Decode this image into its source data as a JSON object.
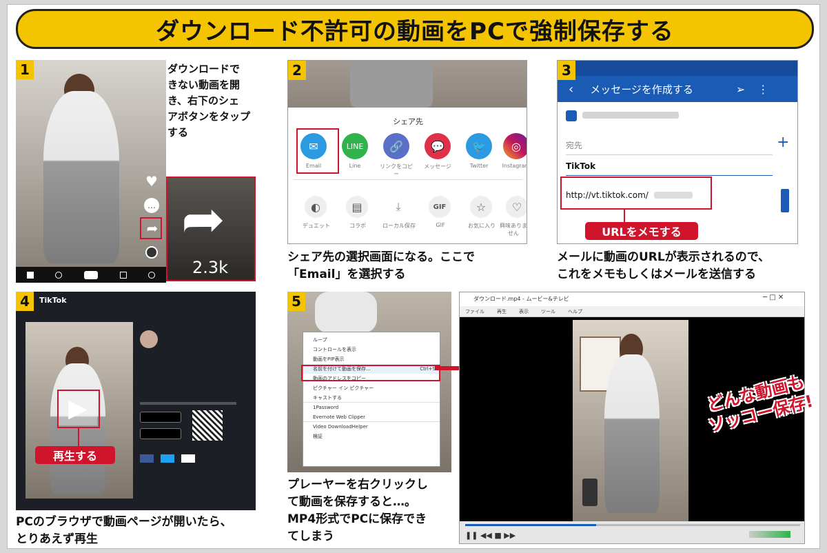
{
  "title": "ダウンロード不許可の動画をPCで強制保存する",
  "steps": [
    {
      "num": "1",
      "caption": [
        "ダウンロードで",
        "きない動画を開",
        "き、右下のシェ",
        "アボタンをタップ",
        "する"
      ]
    },
    {
      "num": "2",
      "caption": [
        "シェア先の選択画面になる。ここで",
        "「Email」を選択する"
      ]
    },
    {
      "num": "3",
      "caption": [
        "メールに動画のURLが表示されるので、",
        "これをメモもしくはメールを送信する"
      ]
    },
    {
      "num": "4",
      "caption": [
        "PCのブラウザで動画ページが開いたら、",
        "とりあえず再生"
      ]
    },
    {
      "num": "5",
      "caption": [
        "プレーヤーを右クリックし",
        "て動画を保存すると…。",
        "MP4形式でPCに保存でき",
        "てしまう"
      ]
    }
  ],
  "step1": {
    "share_count": "2.3k"
  },
  "step2": {
    "sheet_title": "シェア先",
    "share_targets": [
      "Email",
      "Line",
      "リンクをコピー",
      "メッセージ",
      "Twitter",
      "Instagram"
    ],
    "actions": [
      "デュエット",
      "コラボ",
      "ローカル保存",
      "GIF",
      "お気に入り",
      "興味ありません"
    ],
    "gif_label": "GIF"
  },
  "step3": {
    "header": "メッセージを作成する",
    "to_label": "宛先",
    "subject": "TikTok",
    "url": "http://vt.tiktok.com/",
    "callout": "URLをメモする"
  },
  "step4": {
    "site": "TikTok",
    "callout": "再生する"
  },
  "step5": {
    "menu_items": [
      "ループ",
      "コントロールを表示",
      "動画をPIP表示",
      "名前を付けて動画を保存...",
      "動画のアドレスをコピー",
      "ピクチャー イン ピクチャー",
      "キャストする",
      "1Password",
      "Evernote Web Clipper",
      "Video DownloadHelper",
      "検証"
    ],
    "save_shortcut": "Ctrl+S",
    "highlight_index": 3
  },
  "player": {
    "window_title": "ダウンロード.mp4 - ムービー&テレビ",
    "menu": [
      "ファイル",
      "再生",
      "表示",
      "ツール",
      "ヘルプ"
    ]
  },
  "stamp": [
    "どんな動画も",
    "ソッコー保存!"
  ],
  "colors": {
    "yellow": "#f5c400",
    "red": "#d0142c",
    "blue": "#1a5bb5"
  }
}
